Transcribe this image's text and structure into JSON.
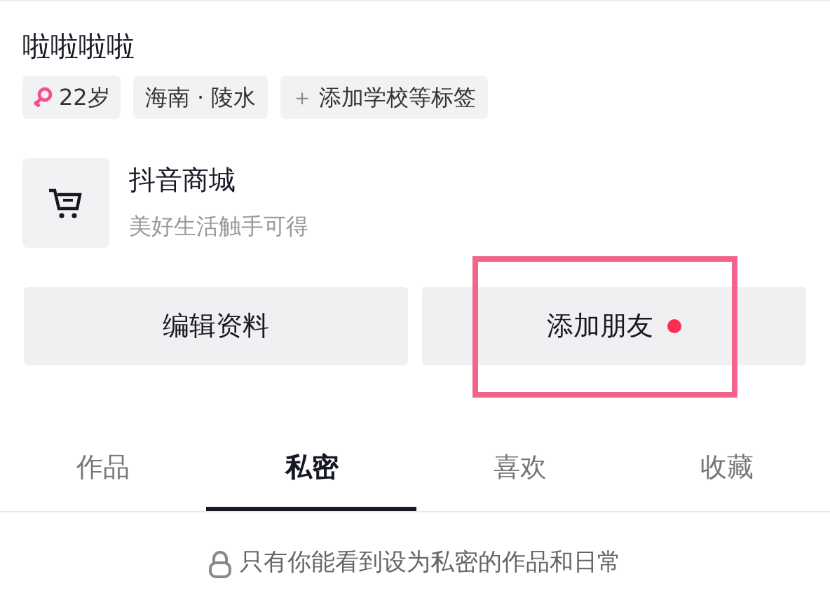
{
  "profile": {
    "name": "啦啦啦啦",
    "tags": [
      {
        "kind": "gender",
        "label": "22岁"
      },
      {
        "kind": "location",
        "label": "海南 · 陵水"
      },
      {
        "kind": "add",
        "icon": "＋",
        "label": "添加学校等标签"
      }
    ]
  },
  "shop": {
    "title": "抖音商城",
    "subtitle": "美好生活触手可得"
  },
  "buttons": [
    {
      "label": "编辑资料",
      "notification_dot": false,
      "highlighted": false
    },
    {
      "label": "添加朋友",
      "notification_dot": true,
      "highlighted": true
    }
  ],
  "tabs": [
    {
      "label": "作品",
      "selected": false
    },
    {
      "label": "私密",
      "selected": true
    },
    {
      "label": "喜欢",
      "selected": false
    },
    {
      "label": "收藏",
      "selected": false
    }
  ],
  "privacy_note": "只有你能看到设为私密的作品和日常"
}
